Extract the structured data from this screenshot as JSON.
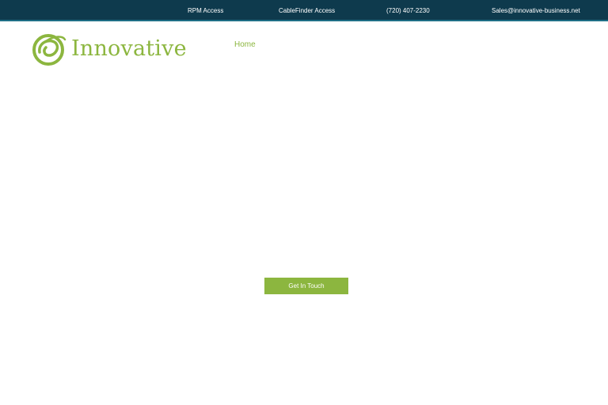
{
  "topbar": {
    "rpm_access": "RPM Access",
    "cablefinder_access": "CableFinder Access",
    "phone": "(720) 407-2230",
    "email": "Sales@innovative-business.net"
  },
  "header": {
    "logo_text": "Innovative",
    "nav": {
      "home": "Home"
    }
  },
  "main": {
    "cta_label": "Get In Touch"
  },
  "colors": {
    "topbar_bg": "#0e3a4d",
    "accent": "#8cb63f"
  },
  "icons": {
    "logo": "innovative-swirl-logo-icon"
  }
}
